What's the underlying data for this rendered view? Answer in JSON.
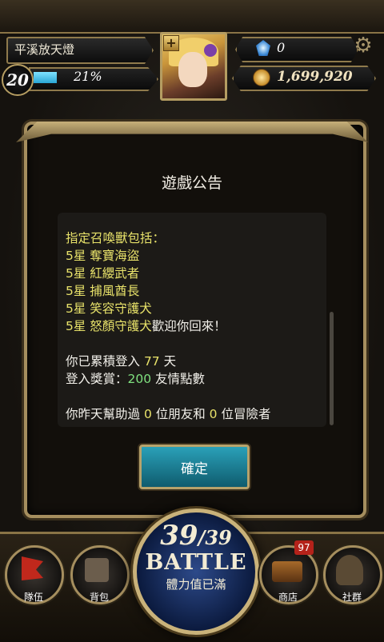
{
  "player": {
    "name": "平溪放天燈",
    "level": "20",
    "exp_percent": "21%",
    "exp_fraction": 0.21
  },
  "currency": {
    "gems": "0",
    "coins": "1,699,920"
  },
  "dialog": {
    "title": "遊戲公告",
    "lines": {
      "l1": "指定召喚獸包括：",
      "l2": "5星 奪寶海盜",
      "l3": "5星 紅纓武者",
      "l4": "5星 捕風酋長",
      "l5": "5星 笑容守護犬",
      "l6a": "5星 怒顏守護犬",
      "l6b": "歡迎你回來！",
      "l7a": "你已累積登入 ",
      "l7b": "77",
      "l7c": " 天",
      "l8a": "登入獎賞：",
      "l8b": "200",
      "l8c": " 友情點數",
      "l9a": "你昨天幫助過 ",
      "l9b": "0",
      "l9c": " 位朋友和 ",
      "l9d": "0",
      "l9e": " 位冒險者"
    },
    "confirm_label": "確定"
  },
  "bottom_nav": {
    "party_label": "隊伍",
    "bag_label": "背包",
    "shop_label": "商店",
    "shop_badge": "97",
    "social_label": "社群"
  },
  "battle": {
    "stamina_current": "39",
    "stamina_max": "/39",
    "label": "BATTLE",
    "status": "體力值已滿"
  },
  "colors": {
    "highlight_yellow": "#e8e26a",
    "highlight_green": "#7fe07f",
    "confirm_teal": "#2aa0b8",
    "gold_frame": "#a58e5e"
  }
}
